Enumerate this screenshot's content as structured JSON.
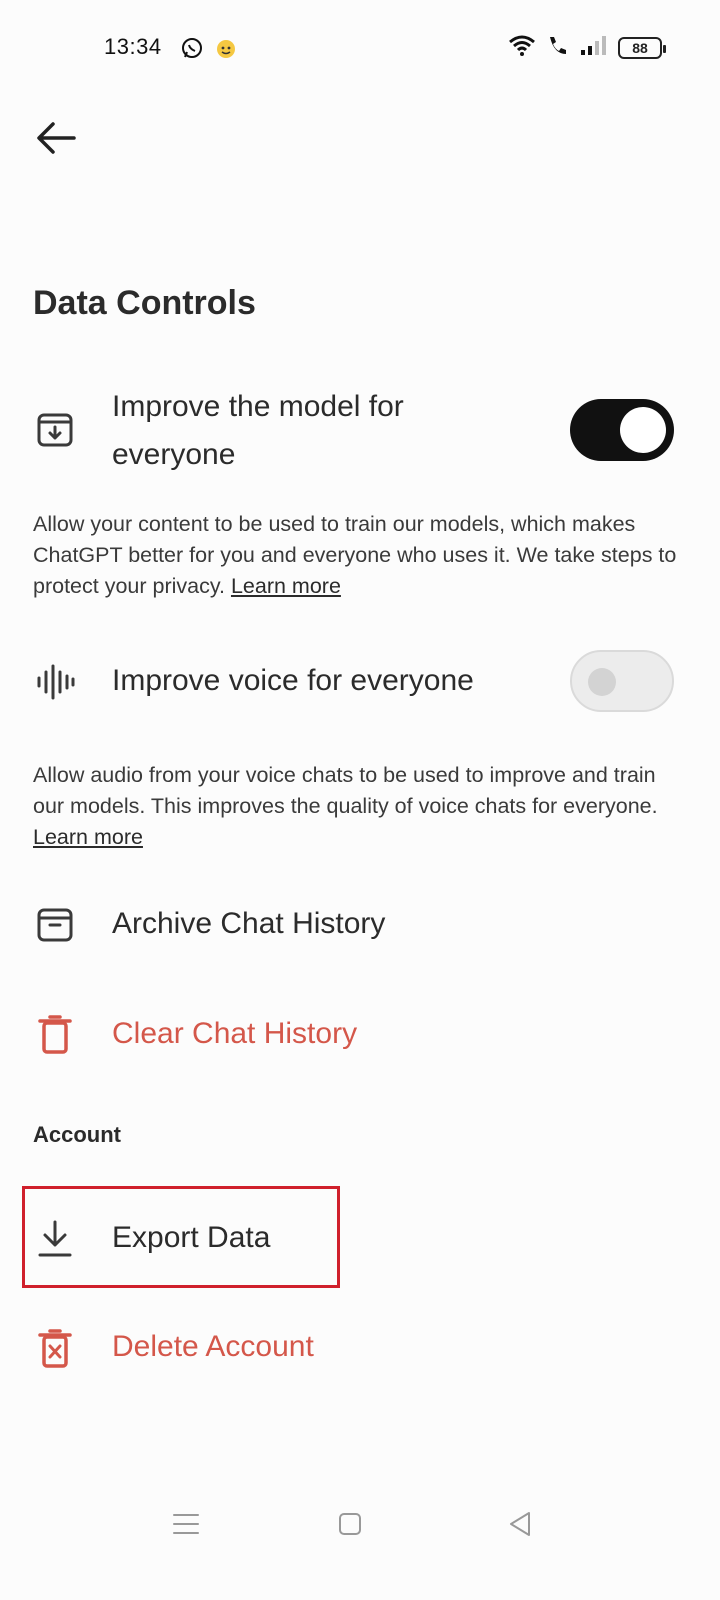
{
  "status_bar": {
    "time": "13:34",
    "battery": "88",
    "icons": [
      "whatsapp-icon",
      "emoji-app-icon",
      "wifi-icon",
      "wifi-call-icon",
      "signal-icon",
      "battery-icon"
    ]
  },
  "header": {
    "back_icon": "arrow-left-icon"
  },
  "page": {
    "title": "Data Controls"
  },
  "settings": {
    "improve_model": {
      "label_line1": "Improve the model for",
      "label_line2": "everyone",
      "toggle_on": true,
      "description": "Allow your content to be used to train our models, which makes ChatGPT better for you and everyone who uses it. We take steps to protect your privacy.",
      "link": "Learn more"
    },
    "improve_voice": {
      "label": "Improve voice for everyone",
      "toggle_on": false,
      "description": "Allow audio from your voice chats to be used to improve and train our models. This improves the quality of voice chats for everyone.",
      "link": "Learn more"
    },
    "archive": {
      "label": "Archive Chat History"
    },
    "clear": {
      "label": "Clear Chat History"
    }
  },
  "account": {
    "section_label": "Account",
    "export": {
      "label": "Export Data"
    },
    "delete": {
      "label": "Delete Account"
    }
  },
  "colors": {
    "danger": "#d4574a",
    "highlight": "#d0202c",
    "toggle_on": "#111111"
  },
  "nav_bar": {
    "icons": [
      "menu-icon",
      "home-square-icon",
      "back-triangle-icon"
    ]
  }
}
